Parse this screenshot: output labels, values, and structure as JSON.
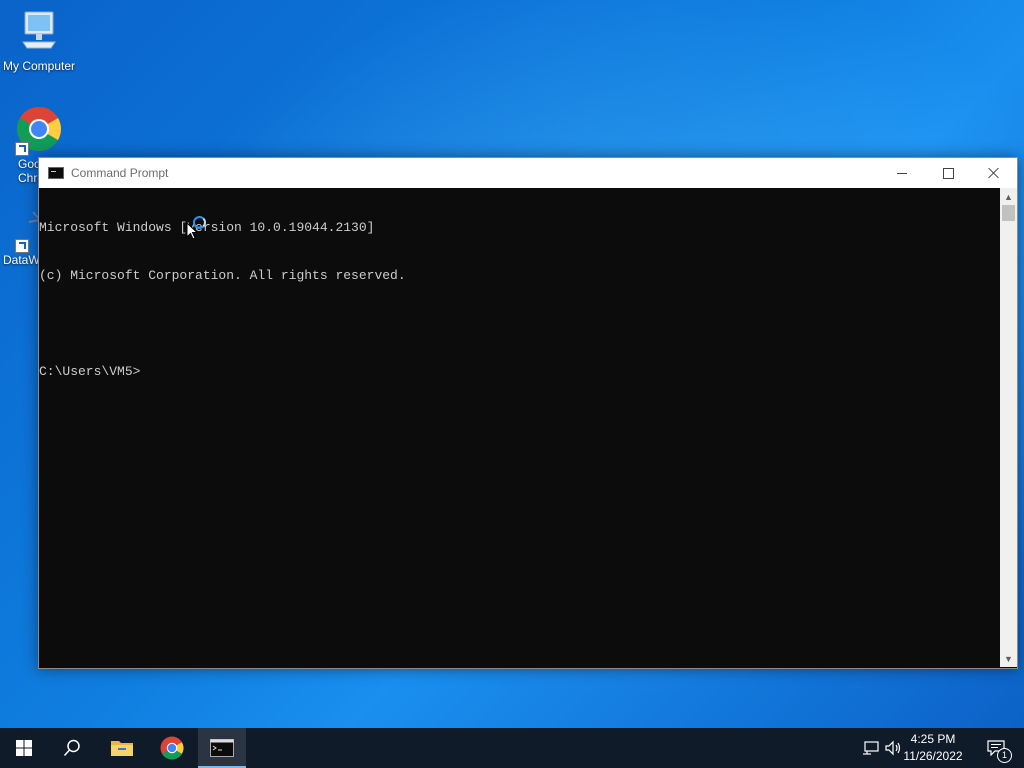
{
  "desktop": {
    "icons": [
      {
        "label": "My Computer",
        "icon": "computer-icon"
      },
      {
        "label": "Goo\nChro",
        "icon": "chrome-icon"
      },
      {
        "label": "DataW",
        "icon": "datawrangler-icon"
      }
    ]
  },
  "window": {
    "title": "Command Prompt",
    "icon": "cmd-icon",
    "console_lines": [
      "Microsoft Windows [Version 10.0.19044.2130]",
      "(c) Microsoft Corporation. All rights reserved.",
      "",
      "C:\\Users\\VM5>"
    ]
  },
  "taskbar": {
    "items": [
      {
        "name": "start-button",
        "icon": "windows-logo-icon"
      },
      {
        "name": "search-button",
        "icon": "search-icon"
      },
      {
        "name": "file-explorer-button",
        "icon": "folder-icon"
      },
      {
        "name": "chrome-button",
        "icon": "chrome-icon"
      },
      {
        "name": "command-prompt-button",
        "icon": "cmd-icon",
        "active": true
      }
    ],
    "clock": {
      "time": "4:25 PM",
      "date": "11/26/2022"
    },
    "notification_count": "1"
  },
  "colors": {
    "console_bg": "#0c0c0c",
    "console_text": "#cccccc",
    "taskbar_bg": "#101b29",
    "accent": "#76b9ed"
  }
}
